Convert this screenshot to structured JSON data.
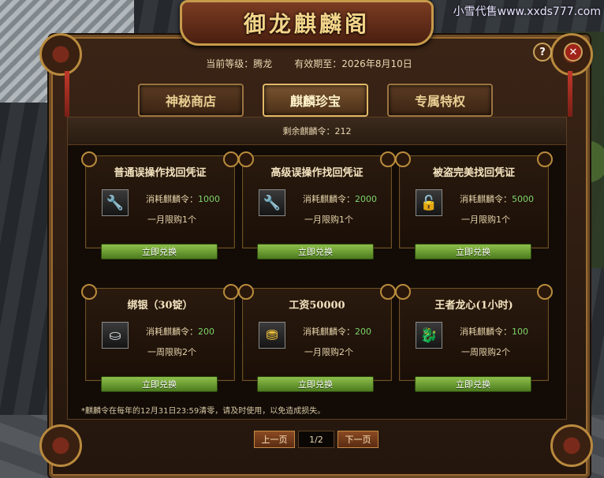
{
  "watermark": "小雪代售www.xxds777.com",
  "title": "御龙麒麟阁",
  "header": {
    "level_label": "当前等级：腾龙",
    "expiry_label": "有效期至：2026年8月10日"
  },
  "buttons": {
    "help": "?",
    "close": "✕"
  },
  "tabs": [
    {
      "label": "神秘商店",
      "active": false
    },
    {
      "label": "麒麟珍宝",
      "active": true
    },
    {
      "label": "专属特权",
      "active": false
    }
  ],
  "remaining": "剩余麒麟令：212",
  "items": [
    {
      "title": "普通误操作找回凭证",
      "cost_label": "消耗麒麟令：",
      "cost": "1000",
      "limit": "一月限购1个",
      "icon": "wrench-icon",
      "button": "立即兑换"
    },
    {
      "title": "高级误操作找回凭证",
      "cost_label": "消耗麒麟令：",
      "cost": "2000",
      "limit": "一月限购1个",
      "icon": "wrench-icon",
      "button": "立即兑换"
    },
    {
      "title": "被盗完美找回凭证",
      "cost_label": "消耗麒麟令：",
      "cost": "5000",
      "limit": "一月限购1个",
      "icon": "lock-icon",
      "button": "立即兑换"
    },
    {
      "title": "绑银（30锭）",
      "cost_label": "消耗麒麟令：",
      "cost": "200",
      "limit": "一周限购2个",
      "icon": "silver-ingot-icon",
      "button": "立即兑换"
    },
    {
      "title": "工资50000",
      "cost_label": "消耗麒麟令：",
      "cost": "200",
      "limit": "一月限购2个",
      "icon": "gold-ingot-icon",
      "button": "立即兑换"
    },
    {
      "title": "王者龙心(1小时)",
      "cost_label": "消耗麒麟令：",
      "cost": "100",
      "limit": "一周限购2个",
      "icon": "dragon-heart-icon",
      "button": "立即兑换"
    }
  ],
  "note": "*麒麟令在每年的12月31日23:59清零，请及时使用，以免造成损失。",
  "pager": {
    "prev": "上一页",
    "page": "1/2",
    "next": "下一页"
  },
  "colors": {
    "accent_gold": "#e2b867",
    "cost_green": "#7ed36b",
    "button_green": "#6a9e30"
  }
}
